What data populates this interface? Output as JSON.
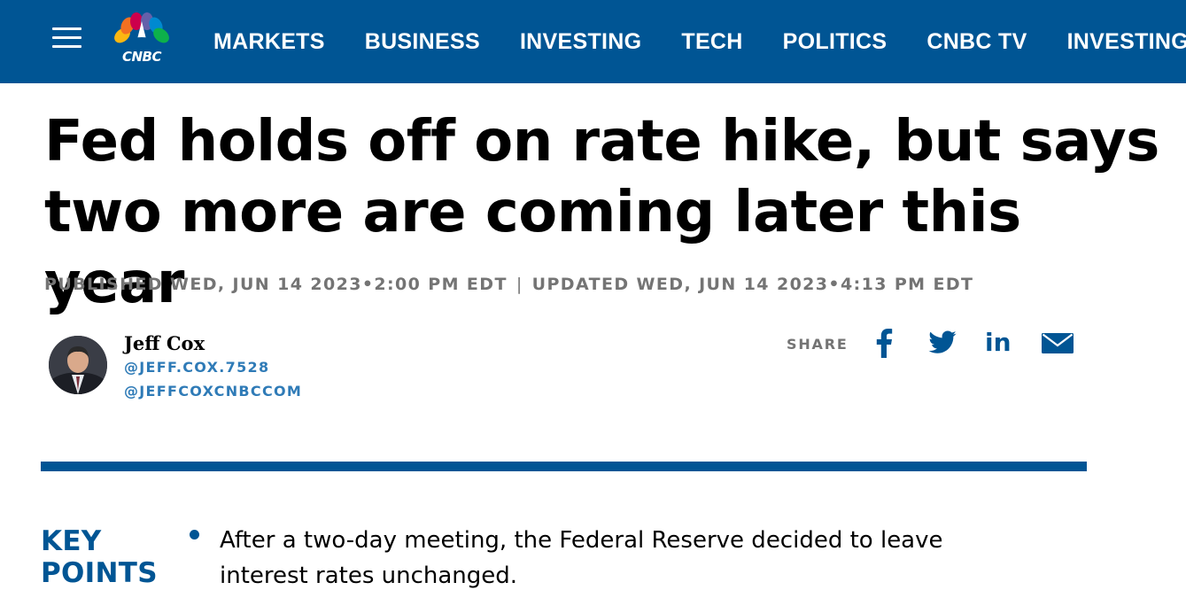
{
  "nav": {
    "logo_text": "CNBC",
    "links": [
      "MARKETS",
      "BUSINESS",
      "INVESTING",
      "TECH",
      "POLITICS",
      "CNBC TV",
      "INVESTING CLUB"
    ]
  },
  "article": {
    "headline_line1": "Fed holds off on rate hike, but says",
    "headline_line2": "two more are coming later this year",
    "published": "PUBLISHED WED, JUN 14 2023•2:00 PM EDT",
    "separator": "|",
    "updated": "UPDATED WED, JUN 14 2023•4:13 PM EDT"
  },
  "author": {
    "name": "Jeff Cox",
    "handle_1": "@JEFF.COX.7528",
    "handle_2": "@JEFFCOXCNBCCOM"
  },
  "share": {
    "label": "SHARE",
    "icons": [
      "facebook-icon",
      "twitter-icon",
      "linkedin-icon",
      "email-icon"
    ],
    "linkedin_text": "in"
  },
  "key_points": {
    "title_line1": "KEY",
    "title_line2": "POINTS",
    "items": [
      "After a two-day meeting, the Federal Reserve decided to leave interest rates unchanged."
    ]
  },
  "colors": {
    "brand_blue": "#005594",
    "link_blue": "#2f7bb7",
    "meta_gray": "#747474"
  }
}
